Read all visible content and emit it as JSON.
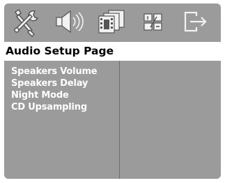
{
  "toolbar": {
    "icons": [
      "general-setup-icon",
      "audio-setup-icon",
      "video-setup-icon",
      "preference-setup-icon",
      "exit-setup-icon"
    ]
  },
  "header": {
    "title": "Audio Setup Page"
  },
  "menu": {
    "items": [
      {
        "label": "Speakers Volume"
      },
      {
        "label": "Speakers Delay"
      },
      {
        "label": "Night Mode"
      },
      {
        "label": "CD Upsampling"
      }
    ]
  },
  "colors": {
    "panel_background": "#9b9b9b",
    "header_background": "#ffffff",
    "header_text": "#000000",
    "menu_text": "#ffffff",
    "icon_light": "#f2f2f2",
    "icon_shadow": "#555555"
  }
}
